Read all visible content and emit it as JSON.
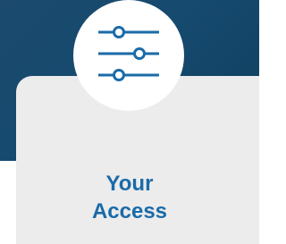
{
  "card": {
    "icon": "sliders-icon",
    "title_line1": "Your",
    "title_line2": "Access"
  },
  "colors": {
    "banner": "#164a6f",
    "card_background": "#ececec",
    "accent": "#1a6ba8",
    "icon_circle": "#ffffff"
  }
}
